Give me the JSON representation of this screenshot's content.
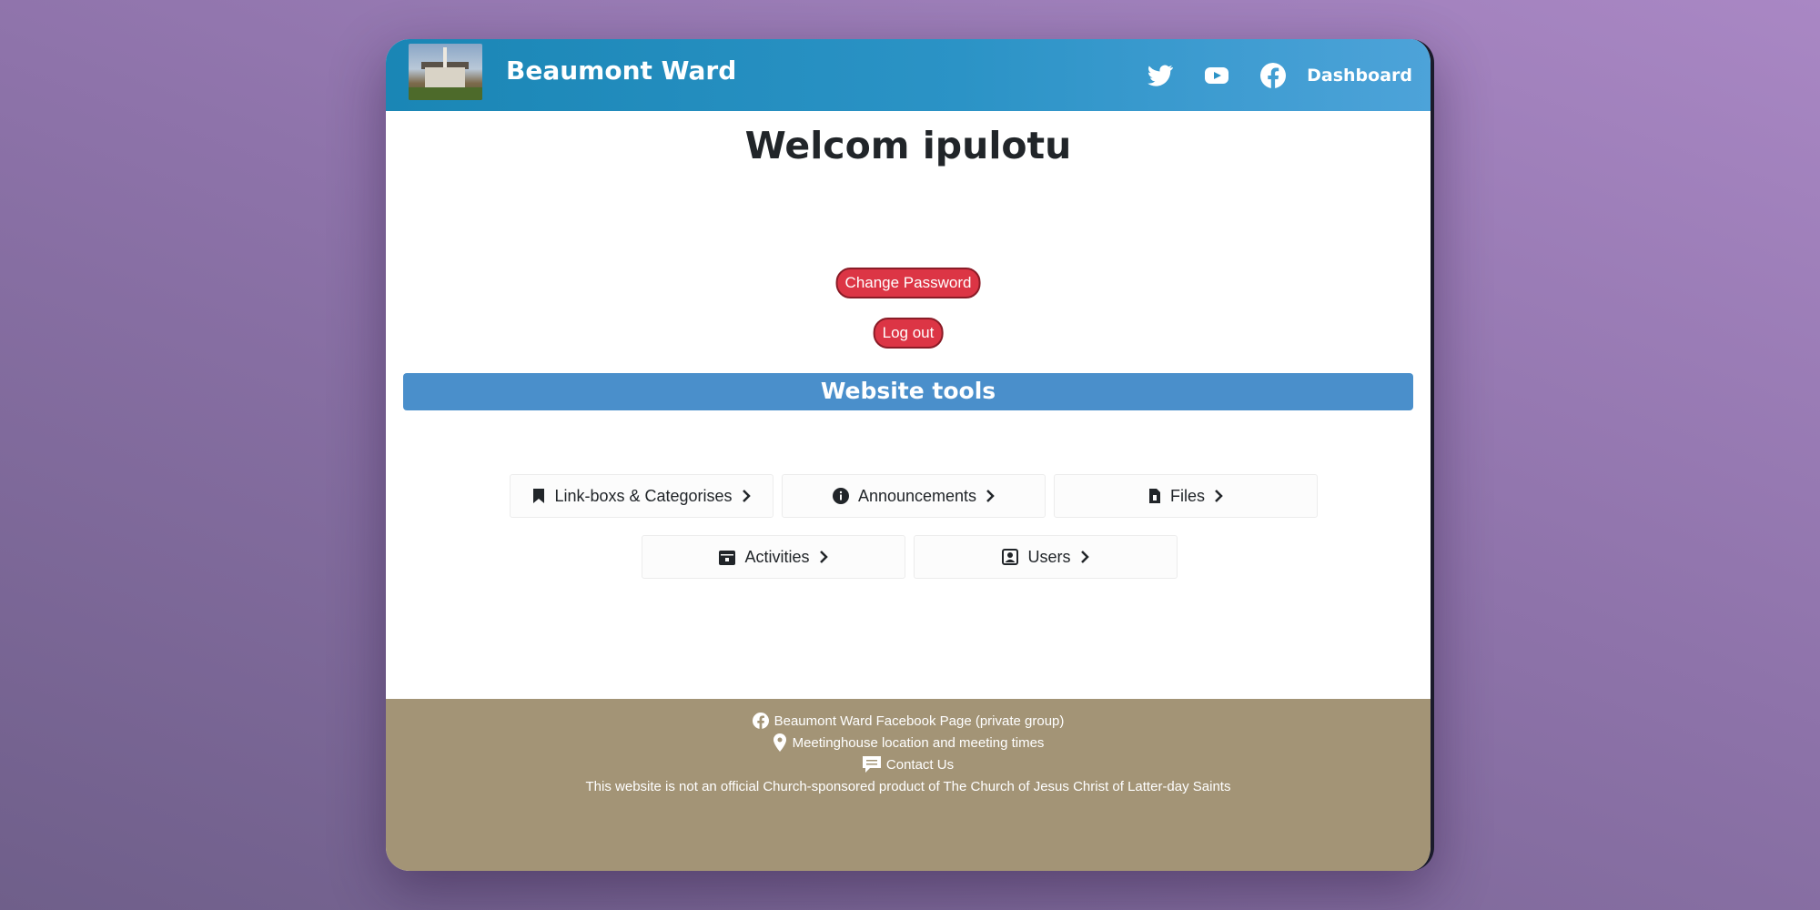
{
  "header": {
    "site_title": "Beaumont Ward",
    "nav": {
      "twitter_icon": "twitter-icon",
      "youtube_icon": "youtube-icon",
      "facebook_icon": "facebook-icon",
      "dashboard_label": "Dashboard"
    }
  },
  "main": {
    "welcome": "Welcom ipulotu",
    "change_password": "Change Password",
    "logout": "Log out",
    "tools_heading": "Website tools",
    "tools": [
      {
        "label": "Link-boxs & Categorises",
        "icon": "bookmark-icon"
      },
      {
        "label": "Announcements",
        "icon": "info-icon"
      },
      {
        "label": "Files",
        "icon": "file-icon"
      },
      {
        "label": "Activities",
        "icon": "calendar-icon"
      },
      {
        "label": "Users",
        "icon": "user-square-icon"
      }
    ]
  },
  "footer": {
    "facebook_link": "Beaumont Ward Facebook Page (private group)",
    "meetinghouse_link": "Meetinghouse location and meeting times",
    "contact_link": "Contact Us",
    "disclaimer": "This website is not an official Church-sponsored product of The Church of Jesus Christ of Latter-day Saints"
  },
  "colors": {
    "header_start": "#1a86b5",
    "header_end": "#4da3d9",
    "danger": "#dc3545",
    "tools_bar": "#4a8fcb",
    "footer": "#a39476"
  }
}
